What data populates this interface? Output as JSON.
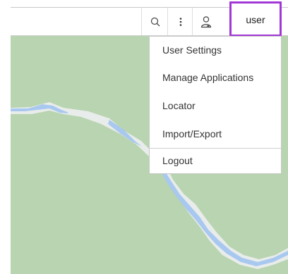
{
  "toolbar": {
    "search_icon": "search-icon",
    "more_icon": "more-vertical-icon",
    "person_icon": "person-icon",
    "user_label": "user",
    "user_highlight_color": "#a237d6"
  },
  "user_menu": {
    "items": [
      {
        "label": "User Settings"
      },
      {
        "label": "Manage Applications"
      },
      {
        "label": "Locator"
      },
      {
        "label": "Import/Export"
      }
    ],
    "logout_label": "Logout"
  },
  "map": {
    "land_color": "#b8d4b0",
    "river_color": "#a8c8f0",
    "bank_color": "#e8ecea"
  }
}
